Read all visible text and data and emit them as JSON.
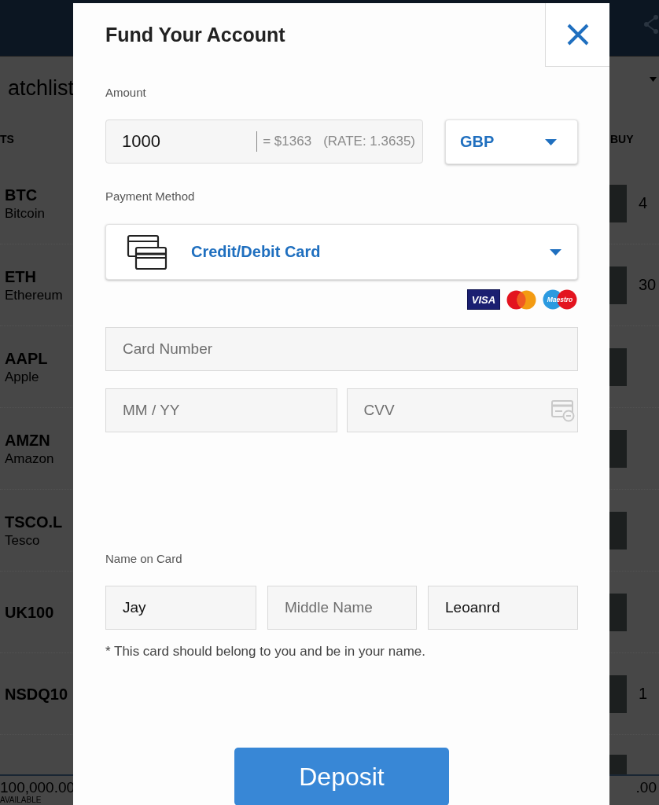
{
  "background": {
    "watchlist_title": "atchlist",
    "columns": [
      "TS",
      "BUY"
    ],
    "rows": [
      {
        "symbol": "BTC",
        "name": "Bitcoin",
        "buy": "4"
      },
      {
        "symbol": "ETH",
        "name": "Ethereum",
        "buy": "30"
      },
      {
        "symbol": "AAPL",
        "name": "Apple"
      },
      {
        "symbol": "AMZN",
        "name": "Amazon"
      },
      {
        "symbol": "TSCO.L",
        "name": "Tesco"
      },
      {
        "symbol": "UK100"
      },
      {
        "symbol": "NSDQ10",
        "buy": "1"
      }
    ],
    "footer": {
      "balance": "100,000.00",
      "balance_label": "AVAILABLE",
      "value_2": ".00"
    }
  },
  "dialog": {
    "title": "Fund Your Account",
    "amount": {
      "label": "Amount",
      "value": "1000",
      "conversion": "= $1363",
      "rate": "(RATE: 1.3635)"
    },
    "currency": {
      "value": "GBP"
    },
    "payment_method": {
      "label": "Payment Method",
      "value": "Credit/Debit Card"
    },
    "accepted_cards": [
      {
        "kind": "visa",
        "label": "VISA"
      },
      {
        "kind": "mastercard"
      },
      {
        "kind": "maestro",
        "label": "Maestro"
      }
    ],
    "card_number": {
      "placeholder": "Card Number"
    },
    "expiry": {
      "placeholder": "MM / YY"
    },
    "cvv": {
      "placeholder": "CVV"
    },
    "name_on_card": {
      "label": "Name on Card",
      "fields": [
        {
          "value": "Jay"
        },
        {
          "placeholder": "Middle Name"
        },
        {
          "value": "Leoanrd"
        }
      ],
      "note": "* This card should belong to you and be in your name."
    },
    "submit": "Deposit"
  }
}
